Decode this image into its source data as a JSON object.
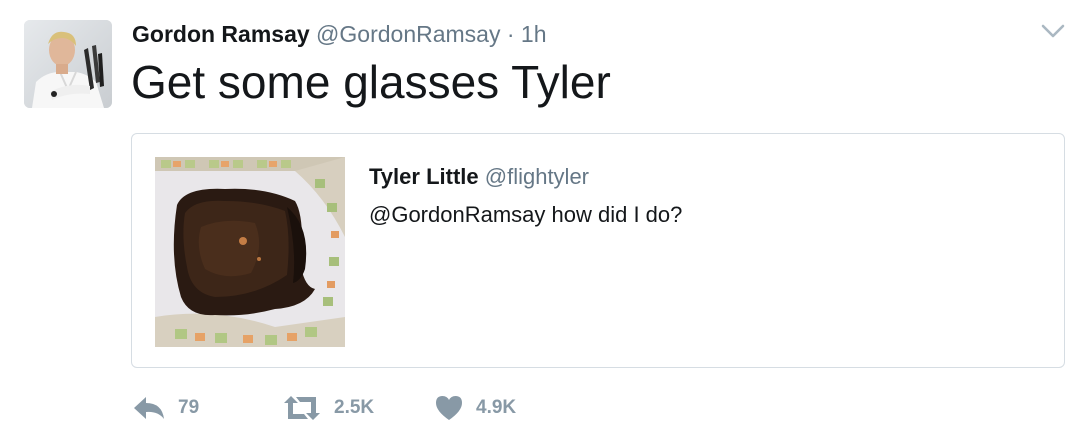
{
  "tweet": {
    "author_name": "Gordon Ramsay",
    "author_handle": "@GordonRamsay",
    "separator": "·",
    "time": "1h",
    "text": "Get some glasses Tyler",
    "avatar_icon": "chef-portrait-avatar",
    "menu_icon": "chevron-down-icon"
  },
  "quoted_tweet": {
    "author_name": "Tyler Little",
    "author_handle": "@flightyler",
    "text": "@GordonRamsay how did I do?",
    "media_description_icon": "burnt-toast-photo"
  },
  "actions": {
    "reply": {
      "icon": "reply-icon",
      "count": "79"
    },
    "retweet": {
      "icon": "retweet-icon",
      "count": "2.5K"
    },
    "like": {
      "icon": "heart-icon",
      "count": "4.9K"
    }
  },
  "colors": {
    "text_primary": "#14171a",
    "text_secondary": "#657786",
    "action_gray": "#8899a6",
    "border": "#d6dde3"
  }
}
